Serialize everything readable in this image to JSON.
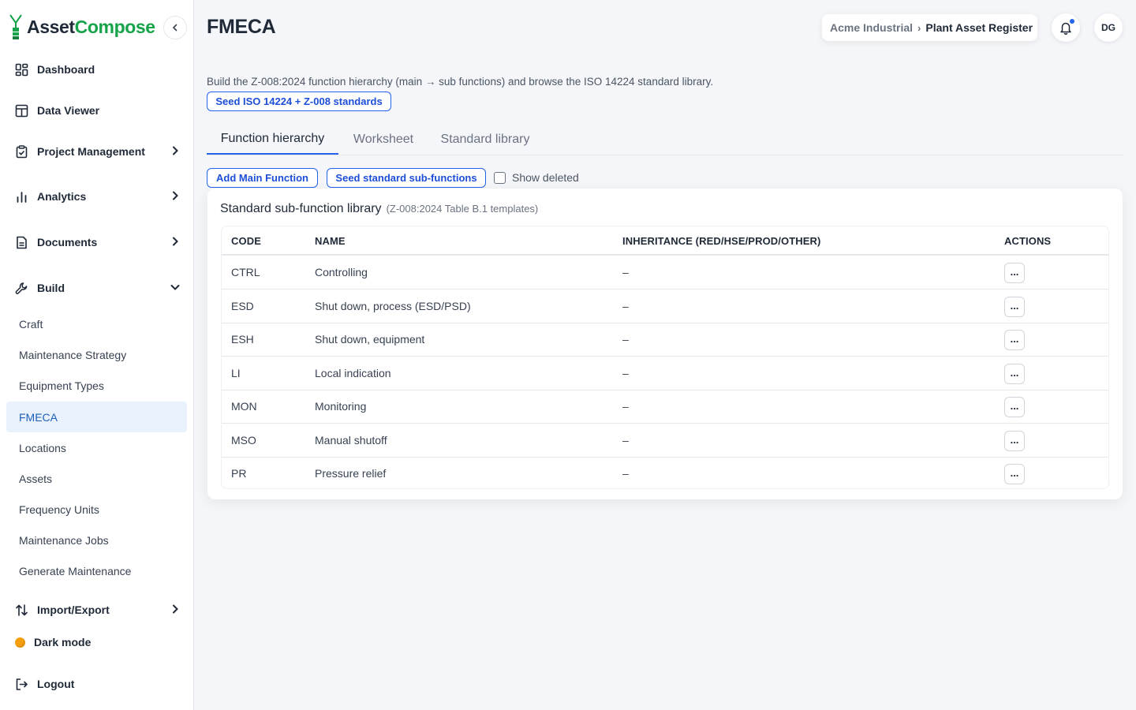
{
  "app": {
    "brand_part1": "Asset",
    "brand_part2": "Compose",
    "brand_color": "#16a34a",
    "accent_color": "#2563eb"
  },
  "sidebar": {
    "items": [
      {
        "label": "Dashboard",
        "icon": "dashboard-icon"
      },
      {
        "label": "Data Viewer",
        "icon": "table-icon"
      },
      {
        "label": "Project Management",
        "icon": "clipboard-icon",
        "expandable": true
      },
      {
        "label": "Analytics",
        "icon": "bar-chart-icon",
        "expandable": true
      },
      {
        "label": "Documents",
        "icon": "document-icon",
        "expandable": true
      },
      {
        "label": "Build",
        "icon": "wrench-icon",
        "expanded": true
      }
    ],
    "build_children": [
      "Craft",
      "Maintenance Strategy",
      "Equipment Types",
      "FMECA",
      "Locations",
      "Assets",
      "Frequency Units",
      "Maintenance Jobs",
      "Generate Maintenance"
    ],
    "active_child": "FMECA",
    "import_export": "Import/Export",
    "dark_mode": "Dark mode",
    "logout": "Logout"
  },
  "header": {
    "title": "FMECA",
    "breadcrumb": [
      "Acme Industrial",
      "Plant Asset Register"
    ],
    "breadcrumb_sep": "›",
    "avatar_initials": "DG"
  },
  "main": {
    "description": "Build the Z-008:2024 function hierarchy (main → sub functions) and browse the ISO 14224 standard library.",
    "seed_button": "Seed ISO 14224 + Z-008 standards",
    "tabs": [
      "Function hierarchy",
      "Worksheet",
      "Standard library"
    ],
    "active_tab": "Function hierarchy",
    "add_main_function": "Add Main Function",
    "seed_sub_functions": "Seed standard sub-functions",
    "show_deleted": "Show deleted",
    "card_title": "Standard sub-function library",
    "card_subtitle": "(Z-008:2024 Table B.1 templates)",
    "columns": [
      "CODE",
      "NAME",
      "INHERITANCE (RED/HSE/PROD/OTHER)",
      "ACTIONS"
    ],
    "rows": [
      {
        "code": "CTRL",
        "name": "Controlling",
        "inheritance": "–",
        "action": "..."
      },
      {
        "code": "ESD",
        "name": "Shut down, process (ESD/PSD)",
        "inheritance": "–",
        "action": "..."
      },
      {
        "code": "ESH",
        "name": "Shut down, equipment",
        "inheritance": "–",
        "action": "..."
      },
      {
        "code": "LI",
        "name": "Local indication",
        "inheritance": "–",
        "action": "..."
      },
      {
        "code": "MON",
        "name": "Monitoring",
        "inheritance": "–",
        "action": "..."
      },
      {
        "code": "MSO",
        "name": "Manual shutoff",
        "inheritance": "–",
        "action": "..."
      },
      {
        "code": "PR",
        "name": "Pressure relief",
        "inheritance": "–",
        "action": "..."
      }
    ]
  }
}
